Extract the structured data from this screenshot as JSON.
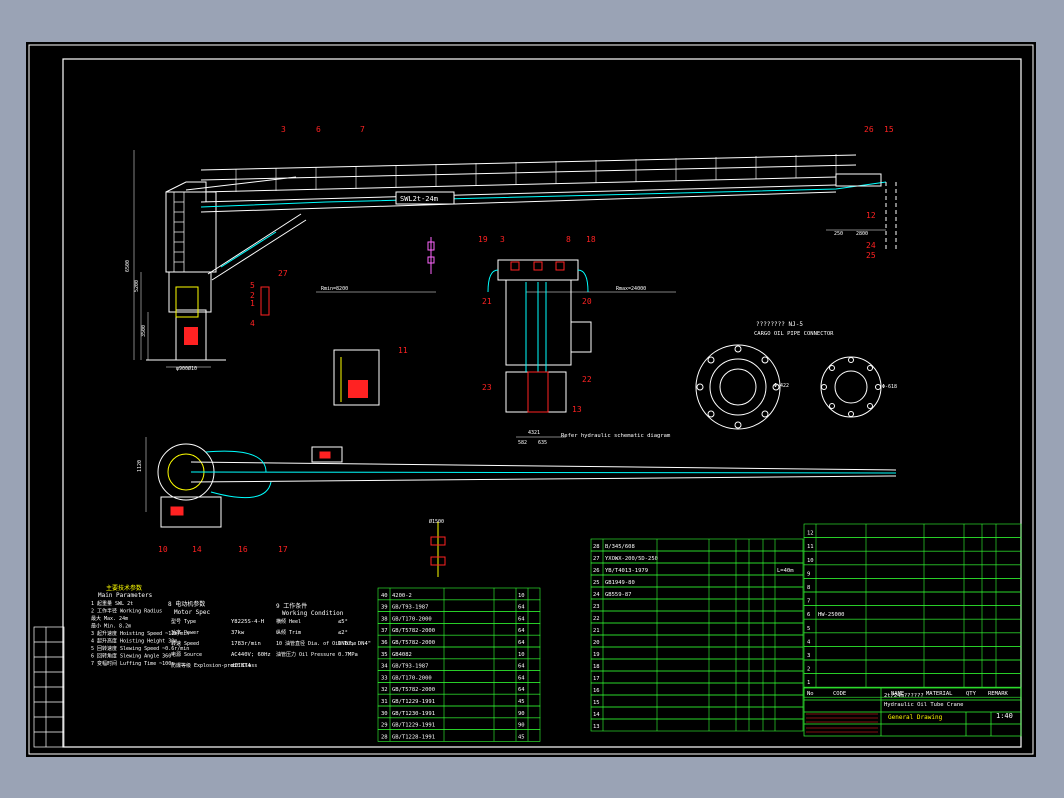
{
  "colors": {
    "frame": "#ffffff",
    "green": "#33ff33",
    "cyan": "#00ffff",
    "yellow": "#ffff00",
    "red": "#ff2222",
    "magenta": "#ff66ff",
    "orange": "#ff8800",
    "white": "#ffffff"
  },
  "drawing": {
    "swl_label": "SWL2t-24m",
    "dim_height": "6500",
    "dim_5200": "5200",
    "dim_3500": "3500",
    "dim_base": "φ900Ø10",
    "dim_rmin": "Rmin=8200",
    "dim_rmax": "Rmax=24000",
    "dim_250": "250",
    "dim_2800": "2800",
    "dim_1000": "1000",
    "dim_4321": "4321",
    "dim_582": "582",
    "dim_635": "635",
    "dim_1120": "1120",
    "dim_9500": "Ø1500",
    "note_hydraulic": "Refer hydraulic schematic diagram",
    "note_cargo_cn": "????????   NJ-5",
    "note_cargo": "CARGO OIL PIPE CONNECTOR",
    "label_phi422": "Φ-422",
    "label_phi618": "Φ-618",
    "scale": "1:40",
    "balloons": [
      "3",
      "6",
      "7",
      "26",
      "15",
      "27",
      "5",
      "2",
      "1",
      "4",
      "11",
      "19",
      "3",
      "8",
      "18",
      "21",
      "20",
      "23",
      "22",
      "13",
      "12",
      "24",
      "25",
      "16",
      "17",
      "10",
      "14",
      "4"
    ]
  },
  "params": {
    "title_cn": "主要技术参数",
    "title_en": "Main Parameters",
    "rows": [
      {
        "n": "1",
        "cn": "起重量",
        "en": "SWL",
        "val": "2t"
      },
      {
        "n": "2",
        "cn": "工作半径",
        "en": "Working Radius",
        "val": ""
      },
      {
        "n": "",
        "cn": "最大",
        "en": "Max.",
        "val": "24m"
      },
      {
        "n": "",
        "cn": "最小",
        "en": "Min.",
        "val": "8.2m"
      },
      {
        "n": "3",
        "cn": "起升速度",
        "en": "Hoisting Speed",
        "val": "~12m/min"
      },
      {
        "n": "4",
        "cn": "起升高度",
        "en": "Hoisting Height",
        "val": "30m"
      },
      {
        "n": "5",
        "cn": "回转速度",
        "en": "Slewing Speed",
        "val": "~0.6r/min"
      },
      {
        "n": "6",
        "cn": "回转角度",
        "en": "Slewing Angle",
        "val": "360°"
      },
      {
        "n": "7",
        "cn": "变幅时间",
        "en": "Luffing Time",
        "val": "~100s"
      }
    ],
    "motor_title": "8 电动机参数",
    "motor_en": "Motor Spec",
    "motor": [
      {
        "k": "型号",
        "e": "Type",
        "v": "Y8225S-4-H"
      },
      {
        "k": "功率",
        "e": "Power",
        "v": "37kw"
      },
      {
        "k": "转速",
        "e": "Speed",
        "v": "1783r/min"
      },
      {
        "k": "电源",
        "e": "Source",
        "v": "AC440V; 60Hz"
      },
      {
        "k": "防爆等级",
        "e": "Explosion-proof Class",
        "v": "dIIBT4"
      }
    ],
    "work_title": "9 工作条件",
    "work_en": "Working Condition",
    "work": [
      {
        "k": "横倾",
        "e": "Heel",
        "v": "≤5°"
      },
      {
        "k": "纵倾",
        "e": "Trim",
        "v": "≤2°"
      },
      {
        "k": "10 油管直径",
        "e": "Dia. of Oil Tube",
        "v": "DN8\", DN4\""
      },
      {
        "k": "油管压力",
        "e": "Oil Pressure",
        "v": "0.7MPa"
      }
    ]
  },
  "bom_left": [
    {
      "no": "40",
      "std": "4200-2",
      "qty": "10"
    },
    {
      "no": "39",
      "std": "GB/T93-1987",
      "qty": "64"
    },
    {
      "no": "38",
      "std": "GB/T170-2000",
      "qty": "64"
    },
    {
      "no": "37",
      "std": "GB/T5782-2000",
      "qty": "64"
    },
    {
      "no": "36",
      "std": "GB/T5782-2000",
      "qty": "64"
    },
    {
      "no": "35",
      "std": "GB4082",
      "qty": "10"
    },
    {
      "no": "34",
      "std": "GB/T93-1987",
      "qty": "64"
    },
    {
      "no": "33",
      "std": "GB/T170-2000",
      "qty": "64"
    },
    {
      "no": "32",
      "std": "GB/T5782-2000",
      "qty": "64"
    },
    {
      "no": "31",
      "std": "GB/T1229-1991",
      "qty": "45"
    },
    {
      "no": "30",
      "std": "GB/T1230-1991",
      "qty": "90"
    },
    {
      "no": "29",
      "std": "GB/T1229-1991",
      "qty": "90"
    },
    {
      "no": "28",
      "std": "GB/T1228-1991",
      "qty": "45"
    }
  ],
  "bom_mid": [
    {
      "no": "28",
      "std": "B/345/608",
      "extra": ""
    },
    {
      "no": "27",
      "std": "YXOWX-200/5D-250",
      "extra": ""
    },
    {
      "no": "26",
      "std": "YB/T4013-1979",
      "extra": "L=40m"
    },
    {
      "no": "25",
      "std": "GB1949-80",
      "extra": ""
    },
    {
      "no": "24",
      "std": "GB559-87",
      "extra": ""
    },
    {
      "no": "23",
      "std": "",
      "extra": ""
    },
    {
      "no": "22",
      "std": "",
      "extra": ""
    },
    {
      "no": "21",
      "std": "",
      "extra": ""
    },
    {
      "no": "20",
      "std": "",
      "extra": ""
    },
    {
      "no": "19",
      "std": "",
      "extra": ""
    },
    {
      "no": "18",
      "std": "",
      "extra": ""
    },
    {
      "no": "17",
      "std": "",
      "extra": ""
    },
    {
      "no": "16",
      "std": "",
      "extra": ""
    },
    {
      "no": "15",
      "std": "",
      "extra": ""
    },
    {
      "no": "14",
      "std": "",
      "extra": ""
    },
    {
      "no": "13",
      "std": "",
      "extra": ""
    }
  ],
  "bom_right": [
    {
      "no": "12",
      "std": ""
    },
    {
      "no": "11",
      "std": ""
    },
    {
      "no": "10",
      "std": ""
    },
    {
      "no": "9",
      "std": ""
    },
    {
      "no": "8",
      "std": ""
    },
    {
      "no": "7",
      "std": ""
    },
    {
      "no": "6",
      "std": "HW-25000"
    },
    {
      "no": "5",
      "std": ""
    },
    {
      "no": "4",
      "std": ""
    },
    {
      "no": "3",
      "std": ""
    },
    {
      "no": "2",
      "std": ""
    },
    {
      "no": "1",
      "std": ""
    }
  ],
  "bom_header": {
    "no": "No",
    "code": "CODE",
    "name": "NAME",
    "material": "MATERIAL",
    "qty": "QTY",
    "remark": "REMARK"
  },
  "title_block": {
    "name_cn": "2t/24m??????",
    "name_en": "Hydraulic Oil Tube Crane",
    "drawing": "General Drawing",
    "scale": "1:40"
  }
}
